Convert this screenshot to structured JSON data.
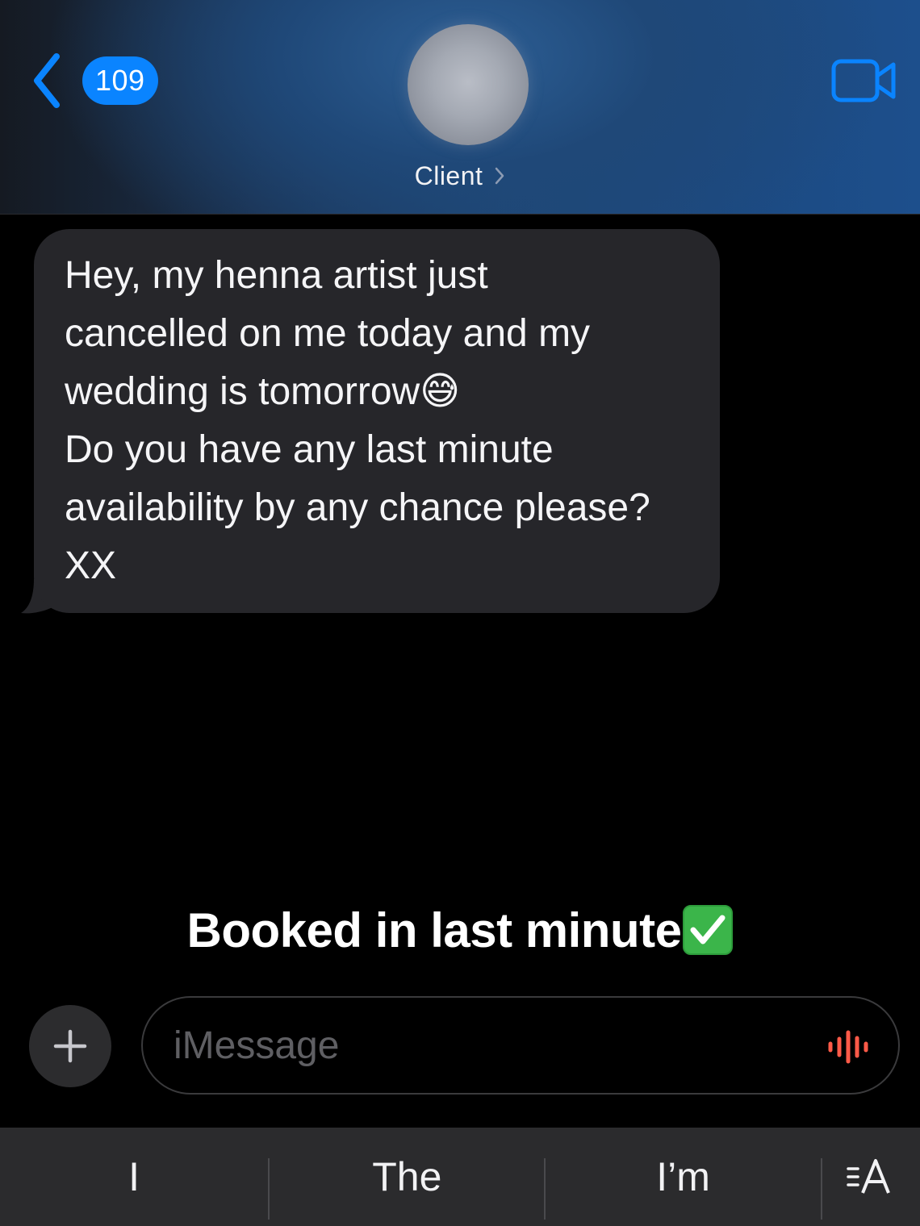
{
  "header": {
    "back_count": "109",
    "contact_name": "Client"
  },
  "conversation": {
    "messages": [
      {
        "direction": "incoming",
        "text": "Hey, my henna artist just\ncancelled on me today and my\nwedding is tomorrow😅\nDo you have any last minute\navailability by any chance please?\nXX"
      }
    ]
  },
  "overlay": {
    "caption": "Booked in last minute",
    "caption_emoji": "✅"
  },
  "input": {
    "placeholder": "iMessage"
  },
  "predictive": {
    "suggestions": [
      "I",
      "The",
      "I’m"
    ]
  },
  "colors": {
    "accent_blue": "#0a84ff",
    "bubble_gray": "#26262a",
    "audio_red": "#ff5a48",
    "check_green": "#3bb54a"
  },
  "icons": {
    "back": "chevron-left-icon",
    "video": "video-camera-icon",
    "plus": "plus-icon",
    "audio": "waveform-icon",
    "format": "text-format-icon"
  }
}
